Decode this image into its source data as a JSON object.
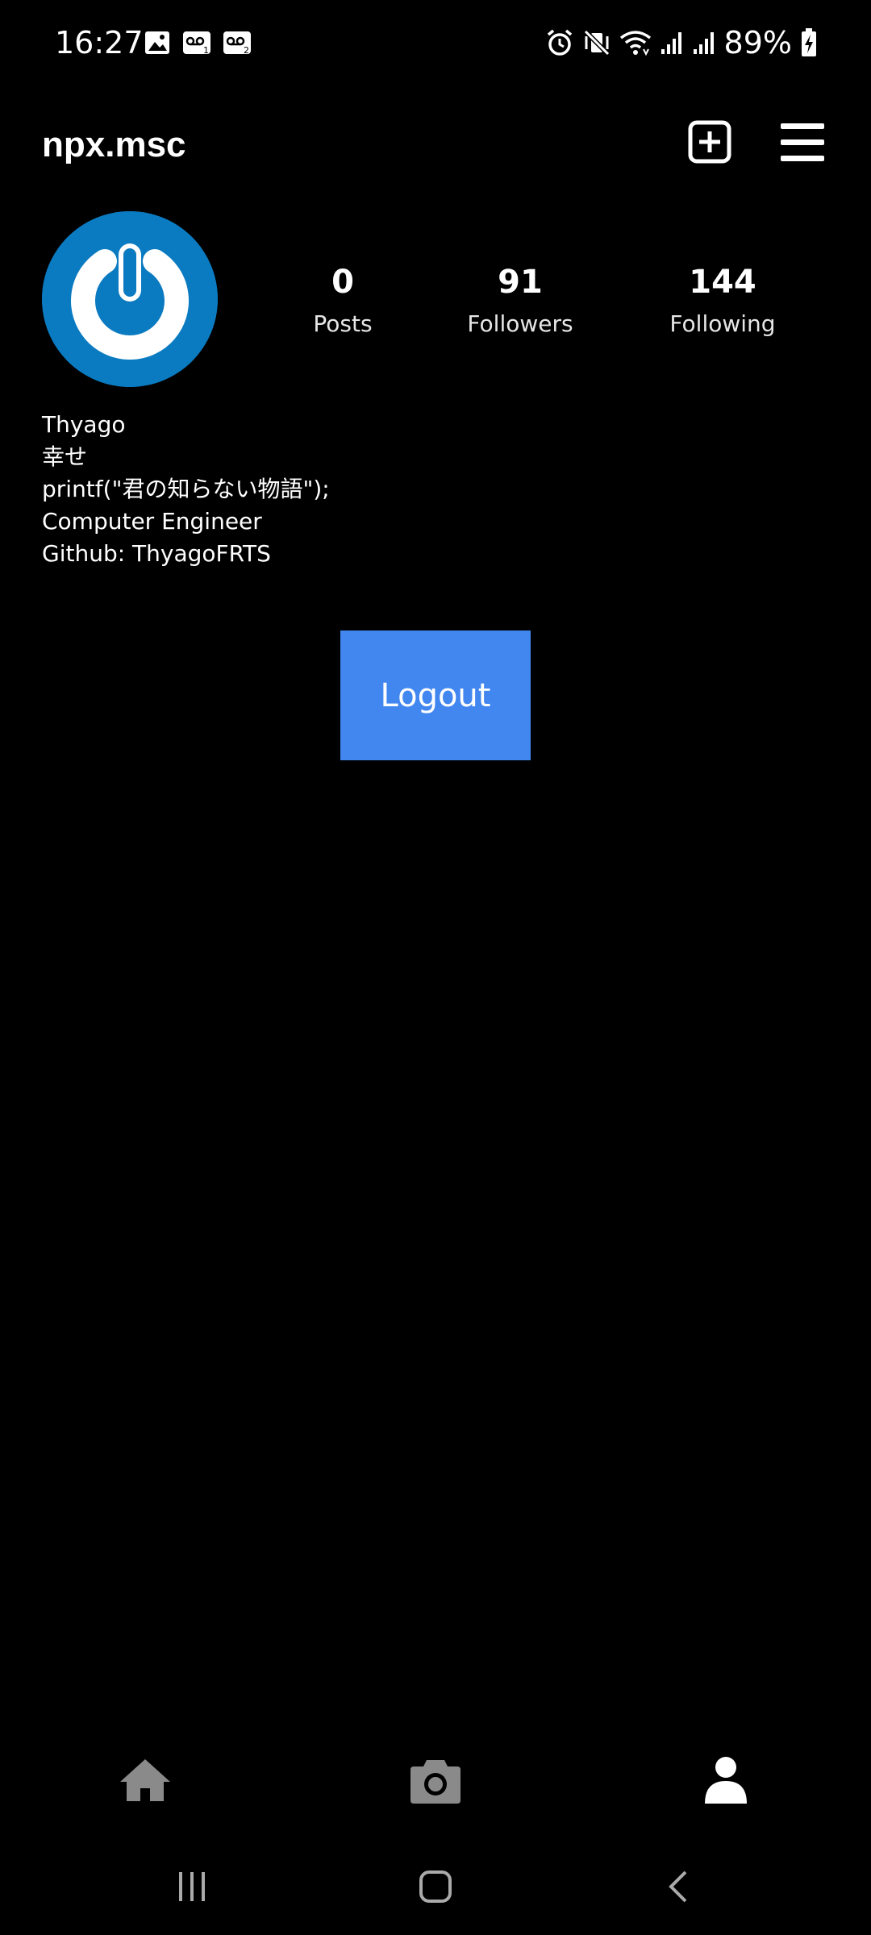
{
  "status_bar": {
    "time": "16:27",
    "battery": "89%",
    "left_icons": [
      "image-icon",
      "voicemail-1-icon",
      "voicemail-2-icon"
    ],
    "right_icons": [
      "alarm-icon",
      "vibrate-mute-icon",
      "wifi-icon",
      "signal-1-icon",
      "signal-2-icon",
      "battery-charging-icon"
    ]
  },
  "app_bar": {
    "username": "npx.msc",
    "add_icon": "plus-square-icon",
    "menu_icon": "hamburger-menu-icon"
  },
  "profile": {
    "avatar_icon": "power-logo-icon",
    "stats": {
      "posts": {
        "value": "0",
        "label": "Posts"
      },
      "followers": {
        "value": "91",
        "label": "Followers"
      },
      "following": {
        "value": "144",
        "label": "Following"
      }
    },
    "bio": {
      "name": "Thyago",
      "line2": "幸せ",
      "line3": "printf(\"君の知らない物語\");",
      "line4": "Computer Engineer",
      "line5": "Github: ThyagoFRTS"
    }
  },
  "actions": {
    "logout_label": "Logout"
  },
  "bottom_nav": {
    "items": [
      "home-icon",
      "camera-icon",
      "profile-icon"
    ],
    "active": "profile-icon"
  },
  "system_nav": {
    "items": [
      "recents-icon",
      "home-button-icon",
      "back-icon"
    ]
  },
  "colors": {
    "background": "#000000",
    "text": "#ffffff",
    "logout_button": "#4287f0",
    "avatar_bg": "#0b7bc1",
    "nav_inactive": "#8a8a8a",
    "nav_active": "#ffffff"
  }
}
